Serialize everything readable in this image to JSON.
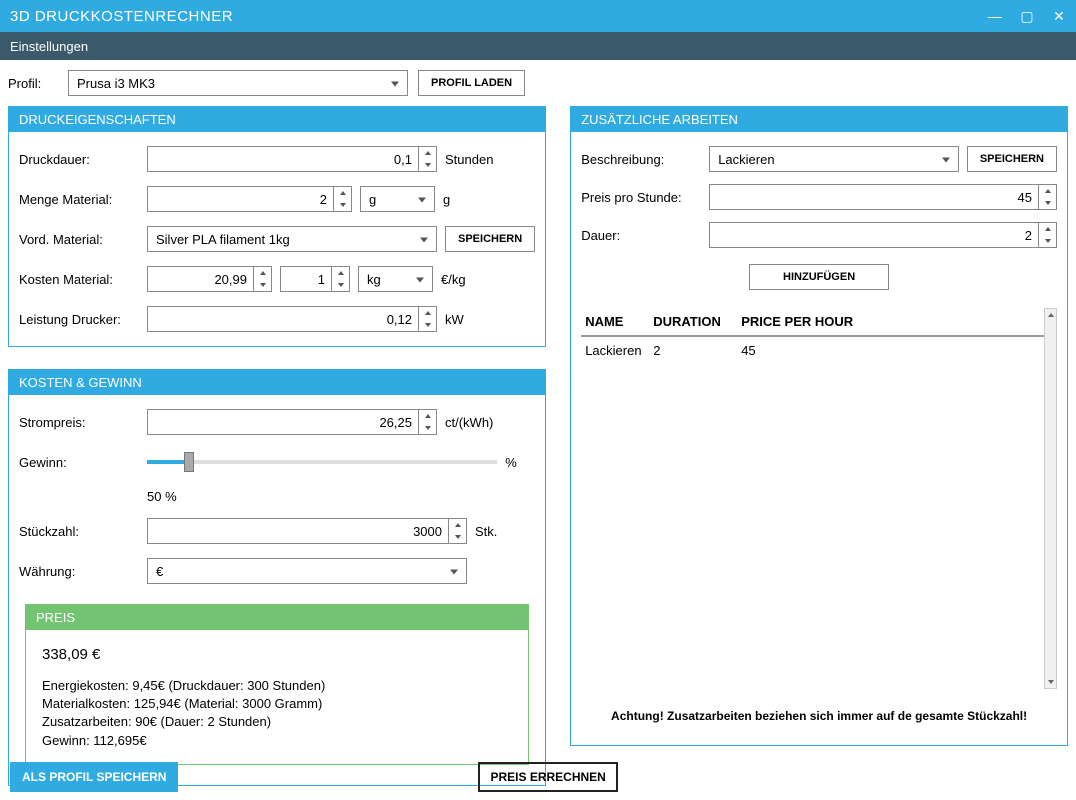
{
  "window": {
    "title": "3D DRUCKKOSTENRECHNER"
  },
  "menu": {
    "settings": "Einstellungen"
  },
  "profile": {
    "label": "Profil:",
    "selected": "Prusa i3 MK3",
    "load_btn": "PROFIL LADEN"
  },
  "print_props": {
    "head": "DRUCKEIGENSCHAFTEN",
    "duration_lbl": "Druckdauer:",
    "duration_val": "0,1",
    "duration_unit": "Stunden",
    "material_qty_lbl": "Menge Material:",
    "material_qty_val": "2",
    "material_qty_unit_sel": "g",
    "material_qty_unit": "g",
    "material_pre_lbl": "Vord. Material:",
    "material_pre_sel": "Silver PLA filament 1kg",
    "material_save_btn": "SPEICHERN",
    "material_cost_lbl": "Kosten Material:",
    "material_cost_val": "20,99",
    "material_cost_qty": "1",
    "material_cost_unit_sel": "kg",
    "material_cost_unit": "€/kg",
    "power_lbl": "Leistung Drucker:",
    "power_val": "0,12",
    "power_unit": "kW"
  },
  "cost_profit": {
    "head": "KOSTEN & GEWINN",
    "energy_lbl": "Strompreis:",
    "energy_val": "26,25",
    "energy_unit": "ct/(kWh)",
    "profit_lbl": "Gewinn:",
    "profit_unit": "%",
    "profit_pct": "50 %",
    "qty_lbl": "Stückzahl:",
    "qty_val": "3000",
    "qty_unit": "Stk.",
    "currency_lbl": "Währung:",
    "currency_sel": "€"
  },
  "price": {
    "head": "PREIS",
    "total": "338,09 €",
    "energy_line": "Energiekosten: 9,45€ (Druckdauer: 300 Stunden)",
    "material_line": "Materialkosten: 125,94€ (Material: 3000 Gramm)",
    "extra_line": "Zusatzarbeiten: 90€ (Dauer: 2 Stunden)",
    "profit_line": "Gewinn: 112,695€"
  },
  "extra": {
    "head": "ZUSÄTZLICHE ARBEITEN",
    "desc_lbl": "Beschreibung:",
    "desc_sel": "Lackieren",
    "save_btn": "SPEICHERN",
    "price_lbl": "Preis pro Stunde:",
    "price_val": "45",
    "duration_lbl": "Dauer:",
    "duration_val": "2",
    "add_btn": "HINZUFÜGEN",
    "col_name": "NAME",
    "col_duration": "DURATION",
    "col_price": "PRICE PER HOUR",
    "row": {
      "name": "Lackieren",
      "duration": "2",
      "price": "45"
    },
    "warning": "Achtung! Zusatzarbeiten beziehen sich immer auf de gesamte Stückzahl!"
  },
  "bottom": {
    "save_profile": "ALS PROFIL SPEICHERN",
    "calc_price": "PREIS ERRECHNEN"
  }
}
